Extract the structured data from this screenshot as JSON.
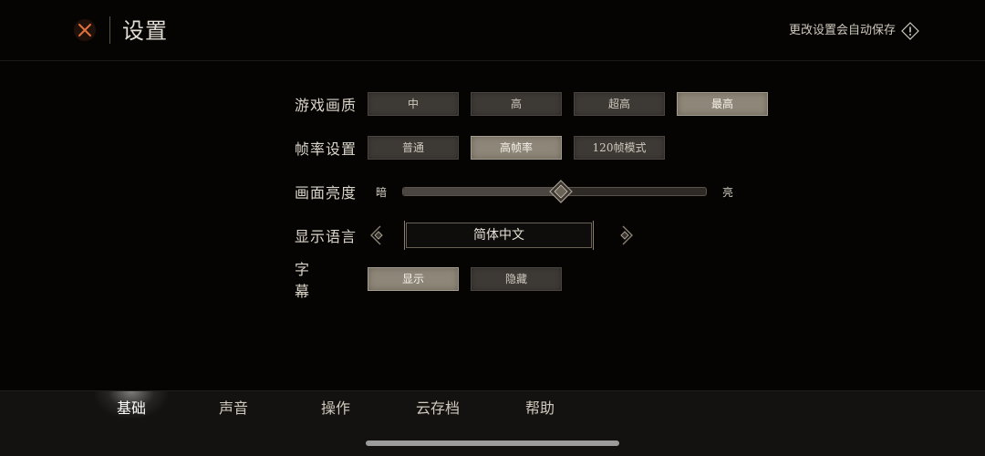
{
  "header": {
    "title": "设置",
    "autosave_text": "更改设置会自动保存",
    "accent_color": "#e0713a"
  },
  "settings": {
    "quality": {
      "label": "游戏画质",
      "options": [
        "中",
        "高",
        "超高",
        "最高"
      ],
      "selected": "最高"
    },
    "framerate": {
      "label": "帧率设置",
      "options": [
        "普通",
        "高帧率",
        "120帧模式"
      ],
      "selected": "高帧率"
    },
    "brightness": {
      "label": "画面亮度",
      "min_label": "暗",
      "max_label": "亮",
      "value": 0.52
    },
    "language": {
      "label": "显示语言",
      "value": "简体中文"
    },
    "subtitles": {
      "label": "字幕",
      "options": [
        "显示",
        "隐藏"
      ],
      "selected": "显示"
    }
  },
  "tabs": [
    {
      "label": "基础",
      "active": true
    },
    {
      "label": "声音",
      "active": false
    },
    {
      "label": "操作",
      "active": false
    },
    {
      "label": "云存档",
      "active": false
    },
    {
      "label": "帮助",
      "active": false
    }
  ]
}
